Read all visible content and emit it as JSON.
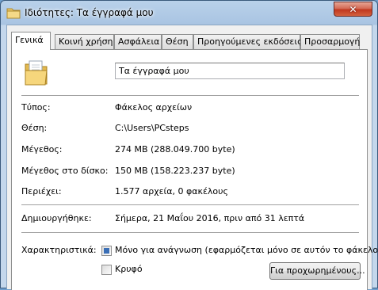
{
  "window": {
    "title": "Ιδιότητες: Τα έγγραφά μου",
    "close_symbol": "✕"
  },
  "tabs": [
    {
      "label": "Γενικά",
      "active": true
    },
    {
      "label": "Κοινή χρήση",
      "active": false
    },
    {
      "label": "Ασφάλεια",
      "active": false
    },
    {
      "label": "Θέση",
      "active": false
    },
    {
      "label": "Προηγούμενες εκδόσεις",
      "active": false
    },
    {
      "label": "Προσαρμογή",
      "active": false
    }
  ],
  "general": {
    "folder_icon": "folder-icon",
    "name_value": "Τα έγγραφά μου",
    "rows": [
      {
        "label": "Τύπος:",
        "value": "Φάκελος αρχείων"
      },
      {
        "label": "Θέση:",
        "value": "C:\\Users\\PCsteps"
      },
      {
        "label": "Μέγεθος:",
        "value": "274 MB (288.049.700 byte)"
      },
      {
        "label": "Μέγεθος στο δίσκο:",
        "value": "150 MB (158.223.237 byte)"
      },
      {
        "label": "Περιέχει:",
        "value": "1.577 αρχεία, 0 φακέλους"
      }
    ],
    "created_label": "Δημιουργήθηκε:",
    "created_value": "Σήμερα, 21 Μαΐου 2016, πριν από 31 λεπτά",
    "attributes_label": "Χαρακτηριστικά:",
    "readonly_label": "Μόνο για ανάγνωση (εφαρμόζεται μόνο σε αυτόν το φάκελο)",
    "readonly_state": "indeterminate",
    "hidden_label": "Κρυφό",
    "hidden_checked": false,
    "advanced_button": "Για προχωρημένους..."
  }
}
